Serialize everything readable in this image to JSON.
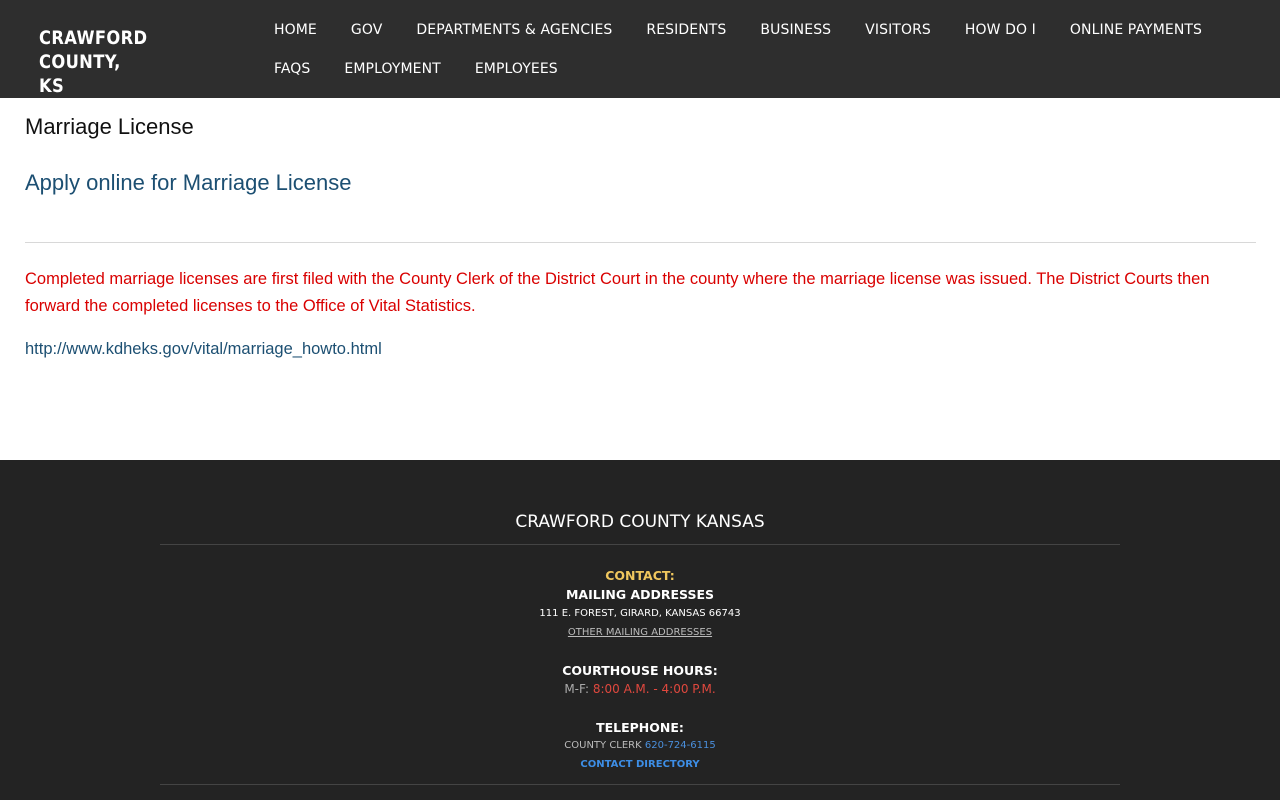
{
  "header": {
    "logo_line1": "CRAWFORD COUNTY,",
    "logo_line2": "KS",
    "nav_row1": [
      "HOME",
      "GOV",
      "DEPARTMENTS & AGENCIES",
      "RESIDENTS",
      "BUSINESS",
      "VISITORS",
      "HOW DO I",
      "ONLINE PAYMENTS"
    ],
    "nav_row2": [
      "FAQS",
      "EMPLOYMENT",
      "EMPLOYEES"
    ]
  },
  "main": {
    "title": "Marriage License",
    "apply_link": "Apply online for Marriage License",
    "notice": "Completed marriage licenses are first filed with the County Clerk of the District Court in the county where the marriage license was issued. The District Courts then forward the completed licenses to the Office of Vital Statistics.",
    "reference_link": "http://www.kdheks.gov/vital/marriage_howto.html"
  },
  "footer": {
    "title": "CRAWFORD COUNTY KANSAS",
    "contact_label": "CONTACT:",
    "mailing_heading": "MAILING ADDRESSES",
    "address": "111 E. FOREST, GIRARD, KANSAS 66743",
    "other_mailing": "OTHER MAILING ADDRESSES",
    "hours_heading": "COURTHOUSE HOURS:",
    "hours_prefix": "M-F: ",
    "hours_value": "8:00 A.M. - 4:00 P.M.",
    "phone_heading": "TELEPHONE:",
    "phone_prefix": "COUNTY CLERK ",
    "phone_number": "620-724-6115",
    "directory_link": "CONTACT DIRECTORY"
  },
  "colors": {
    "header_bg": "#2e2e2e",
    "footer_bg": "#232323",
    "link_blue": "#1c4f72",
    "notice_red": "#d90000",
    "contact_gold": "#f0c75e",
    "hours_red": "#e0483e",
    "footer_link_blue": "#3d8ee6"
  }
}
